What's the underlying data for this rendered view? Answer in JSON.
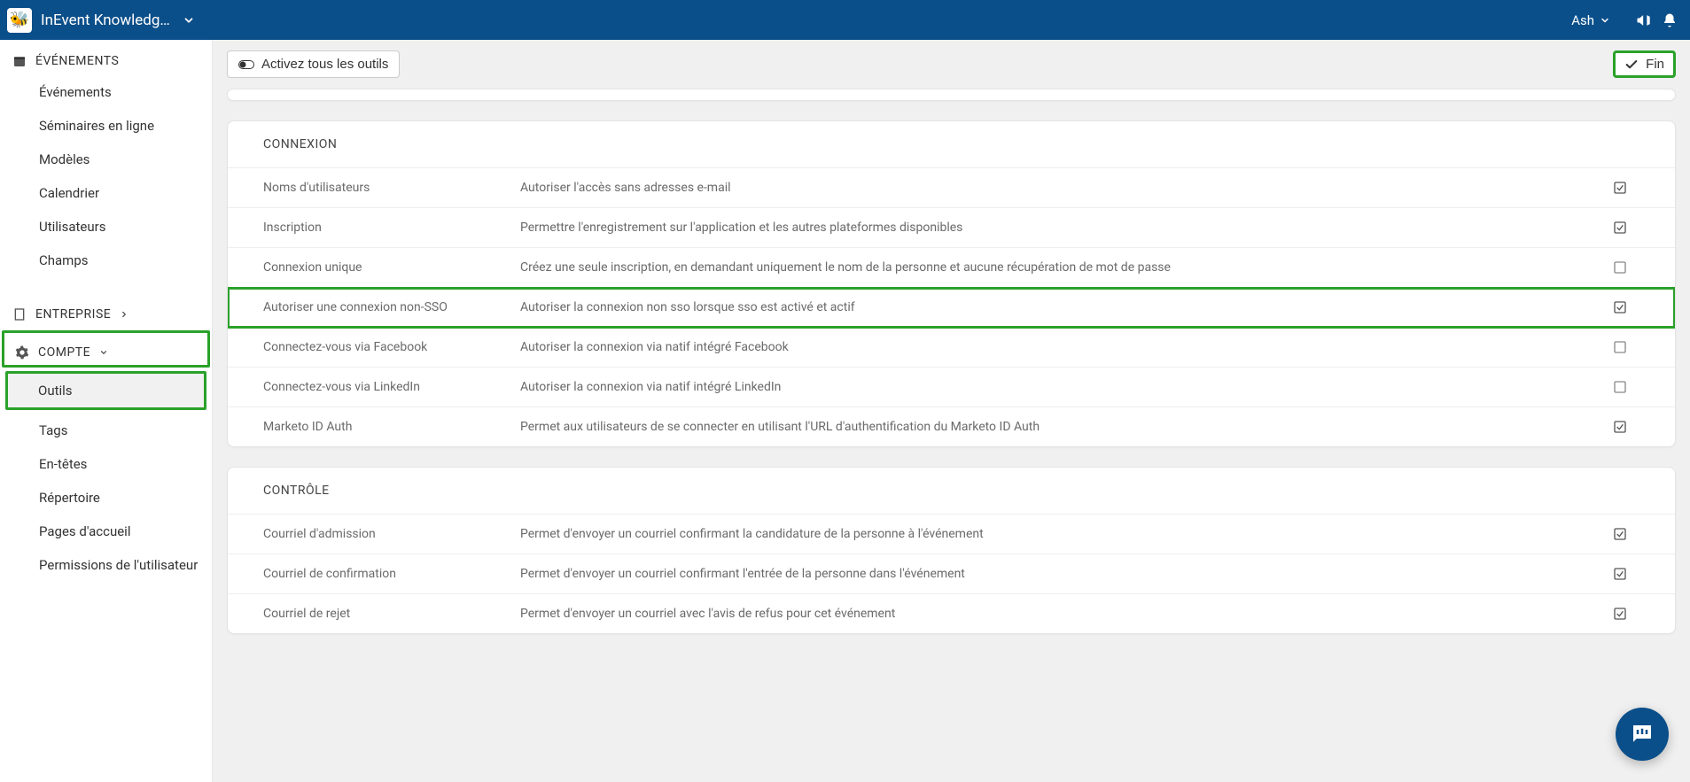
{
  "colors": {
    "primary": "#0b4f8a",
    "highlight_border": "#2aa12a"
  },
  "topbar": {
    "app_title": "InEvent Knowledge …",
    "user_name": "Ash"
  },
  "toolbar": {
    "activate_all_label": "Activez tous les outils",
    "finish_label": "Fin"
  },
  "sidebar": {
    "events_section": "ÉVÉNEMENTS",
    "events_items": [
      "Événements",
      "Séminaires en ligne",
      "Modèles",
      "Calendrier",
      "Utilisateurs",
      "Champs"
    ],
    "company_section": "ENTREPRISE",
    "account_section": "COMPTE",
    "account_items": [
      "Outils",
      "Tags",
      "En-têtes",
      "Répertoire",
      "Pages d'accueil",
      "Permissions de l'utilisateur"
    ]
  },
  "panels": [
    {
      "title": "CONNEXION",
      "rows": [
        {
          "name": "Noms d'utilisateurs",
          "desc": "Autoriser l'accès sans adresses e-mail",
          "checked": true
        },
        {
          "name": "Inscription",
          "desc": "Permettre l'enregistrement sur l'application et les autres plateformes disponibles",
          "checked": true
        },
        {
          "name": "Connexion unique",
          "desc": "Créez une seule inscription, en demandant uniquement le nom de la personne et aucune récupération de mot de passe",
          "checked": false
        },
        {
          "name": "Autoriser une connexion non-SSO",
          "desc": "Autoriser la connexion non sso lorsque sso est activé et actif",
          "checked": true,
          "highlight": true
        },
        {
          "name": "Connectez-vous via Facebook",
          "desc": "Autoriser la connexion via natif intégré Facebook",
          "checked": false
        },
        {
          "name": "Connectez-vous via LinkedIn",
          "desc": "Autoriser la connexion via natif intégré LinkedIn",
          "checked": false
        },
        {
          "name": "Marketo ID Auth",
          "desc": "Permet aux utilisateurs de se connecter en utilisant l'URL d'authentification du Marketo ID Auth",
          "checked": true
        }
      ]
    },
    {
      "title": "CONTRÔLE",
      "rows": [
        {
          "name": "Courriel d'admission",
          "desc": "Permet d'envoyer un courriel confirmant la candidature de la personne à l'événement",
          "checked": true
        },
        {
          "name": "Courriel de confirmation",
          "desc": "Permet d'envoyer un courriel confirmant l'entrée de la personne dans l'événement",
          "checked": true
        },
        {
          "name": "Courriel de rejet",
          "desc": "Permet d'envoyer un courriel avec l'avis de refus pour cet événement",
          "checked": true
        }
      ]
    }
  ]
}
